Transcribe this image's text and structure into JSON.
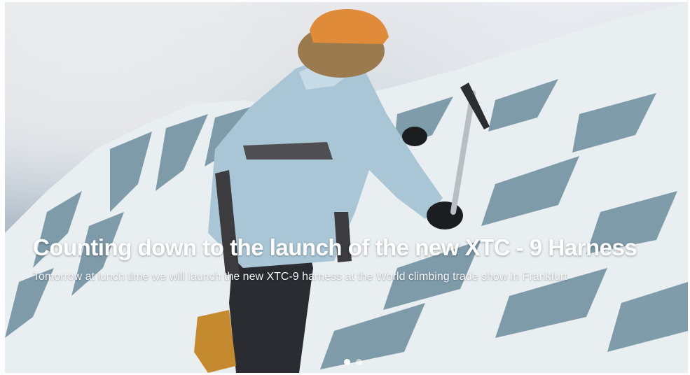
{
  "slide": {
    "title": "Counting down to the launch of the new XTC - 9 Harness",
    "description": "Tomorrow at lunch time we will launch the new XTC-9 harness at the World climbing trade show in Frankfurt"
  },
  "carousel": {
    "total_slides": 2,
    "active_index": 0
  },
  "colors": {
    "title_text": "#ffffff",
    "helmet": "#e08b3a",
    "jacket": "#a9c6d6",
    "ice_shadow": "#4d7486"
  },
  "icons": [
    "ice-axe-icon"
  ]
}
